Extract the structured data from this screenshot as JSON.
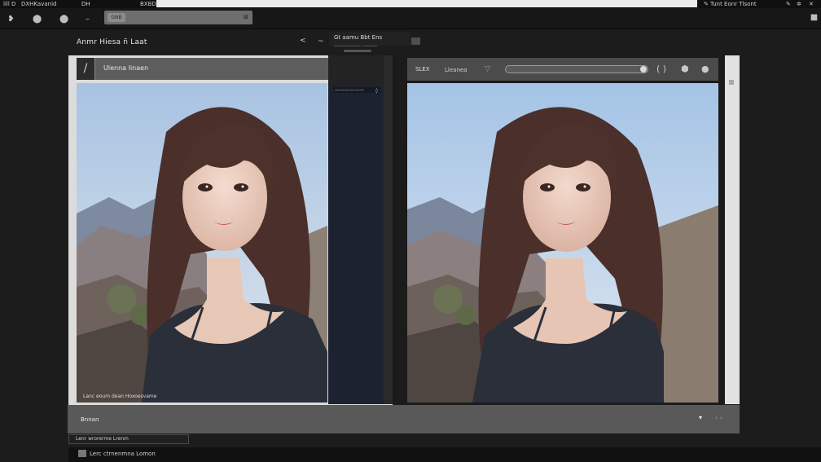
{
  "menu": {
    "items": [
      "lill",
      "D",
      "DXHKavanid",
      "DH",
      "BXBD"
    ],
    "right_text": "Tunt Eonr Tlsont",
    "right_icons": [
      "pencil-icon",
      "gear-icon",
      "close-icon"
    ]
  },
  "toolbar": {
    "icons": [
      "bookmark-icon",
      "blob-icon",
      "blob-icon",
      "dash-icon"
    ],
    "search_pill": "GNB",
    "search_close": "⊠"
  },
  "header": {
    "title": "Anmr Hiesa ñ Laat",
    "icons": [
      "<",
      "~"
    ],
    "popup_text": "Gt aamu Bbt Ens",
    "popup_sub": "___________ ______"
  },
  "left_panel": {
    "title": "Ulenna Iinaen",
    "tool_icon": "/",
    "sidebar_label": "——————",
    "sidebar_close": "◊",
    "caption": "Lanc eoum dean Hoxoesvame"
  },
  "right_panel": {
    "label1": "SLEX",
    "label2": "Lleanea",
    "funnel_icon": "▽",
    "icons": [
      "( )",
      "⬢",
      "●"
    ]
  },
  "bottom_bar": {
    "label": "Bnnan",
    "icons": [
      "▾",
      "‹ ›"
    ]
  },
  "status": {
    "strip1": "Lenr wrorerme Lrenm",
    "strip2": "Lerc ctrnenmna Lomon"
  },
  "colors": {
    "background": "#1c1c1c",
    "panel_light": "#dcdcdc",
    "header_gray": "#5d5d5d",
    "accent_navy": "#1d2230"
  }
}
